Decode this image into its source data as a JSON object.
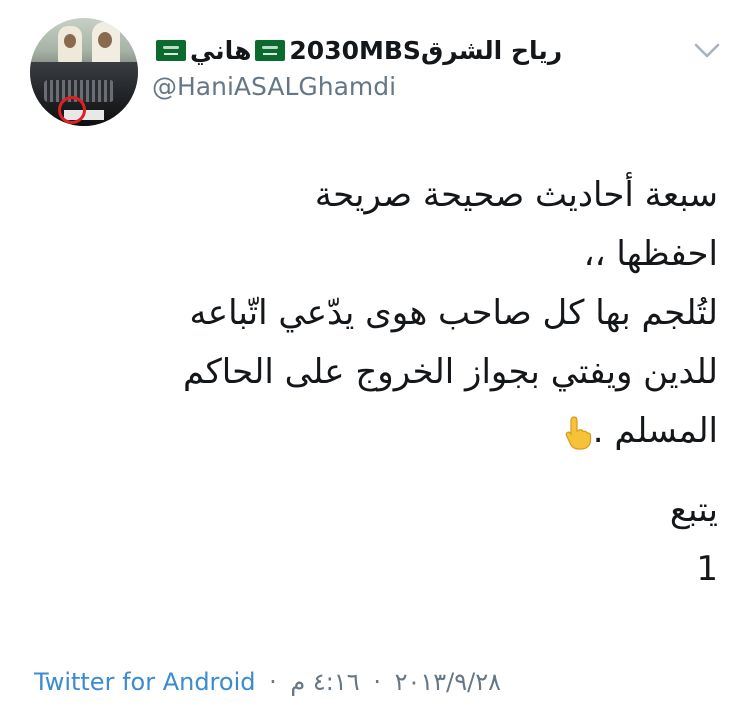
{
  "author": {
    "display_name_part1": "رياح الشرق",
    "display_name_part2": "2030MBS",
    "display_name_part3": "هاني",
    "handle": "@HaniASALGhamdi",
    "flag_icon": "saudi-flag-icon",
    "avatar": "profile-avatar"
  },
  "menu": {
    "icon": "chevron-down-icon"
  },
  "tweet": {
    "lines": [
      "سبعة أحاديث صحيحة صريحة",
      "احفظها ،،",
      "لتُلجم بها كل صاحب هوى يدّعي اتّباعه",
      "للدين ويفتي بجواز الخروج على الحاكم",
      "المسلم ."
    ],
    "pointer_icon": "backhand-index-pointing-down-icon",
    "follow_label": "يتبع",
    "number": "1"
  },
  "meta": {
    "time": "٤:١٦ م",
    "date": "٢٠١٣/٩/٢٨",
    "separator": "·",
    "source": "Twitter for Android"
  },
  "colors": {
    "text": "#14171a",
    "muted": "#657786",
    "link": "#3a8bd1"
  }
}
